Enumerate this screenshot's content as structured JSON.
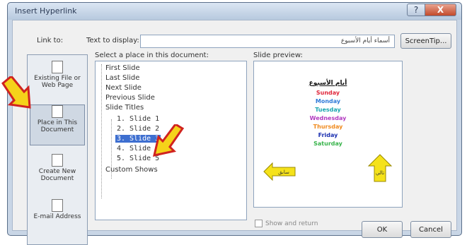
{
  "window": {
    "title": "Insert Hyperlink",
    "help_glyph": "?",
    "close_glyph": "X"
  },
  "header": {
    "link_to_label": "Link to:",
    "text_to_display_label": "Text to display:",
    "text_to_display_value": "أسماء أيام الأسبوع",
    "screentip_button": "ScreenTip..."
  },
  "sidebar": {
    "items": [
      {
        "label": "Existing File or Web Page"
      },
      {
        "label": "Place in This Document"
      },
      {
        "label": "Create New Document"
      },
      {
        "label": "E-mail Address"
      }
    ]
  },
  "tree": {
    "heading": "Select a place in this document:",
    "items": [
      {
        "label": "First Slide"
      },
      {
        "label": "Last Slide"
      },
      {
        "label": "Next Slide"
      },
      {
        "label": "Previous Slide"
      },
      {
        "label": "Slide Titles"
      },
      {
        "label": "1. Slide 1"
      },
      {
        "label": "2. Slide 2"
      },
      {
        "label": "3. Slide 3"
      },
      {
        "label": "4. Slide 4"
      },
      {
        "label": "5. Slide 5"
      },
      {
        "label": "Custom Shows"
      }
    ]
  },
  "preview": {
    "heading": "Slide preview:",
    "slide_title": "أيام الأسبوع",
    "days": [
      {
        "name": "Sunday",
        "color": "#e0283c"
      },
      {
        "name": "Monday",
        "color": "#2f7ad8"
      },
      {
        "name": "Tuesday",
        "color": "#1aa6b0"
      },
      {
        "name": "Wednesday",
        "color": "#b23ac0"
      },
      {
        "name": "Thursday",
        "color": "#f08a1e"
      },
      {
        "name": "Friday",
        "color": "#1a2fb0"
      },
      {
        "name": "Saturday",
        "color": "#37b34a"
      }
    ],
    "back_button_label": "سابق",
    "next_button_label": "تالي"
  },
  "options": {
    "show_and_return_label": "Show and return"
  },
  "footer": {
    "ok_label": "OK",
    "cancel_label": "Cancel"
  },
  "colors": {
    "arrow": "#f5d21a",
    "arrow_outline": "#d0231f",
    "selection": "#3e6fd0"
  }
}
